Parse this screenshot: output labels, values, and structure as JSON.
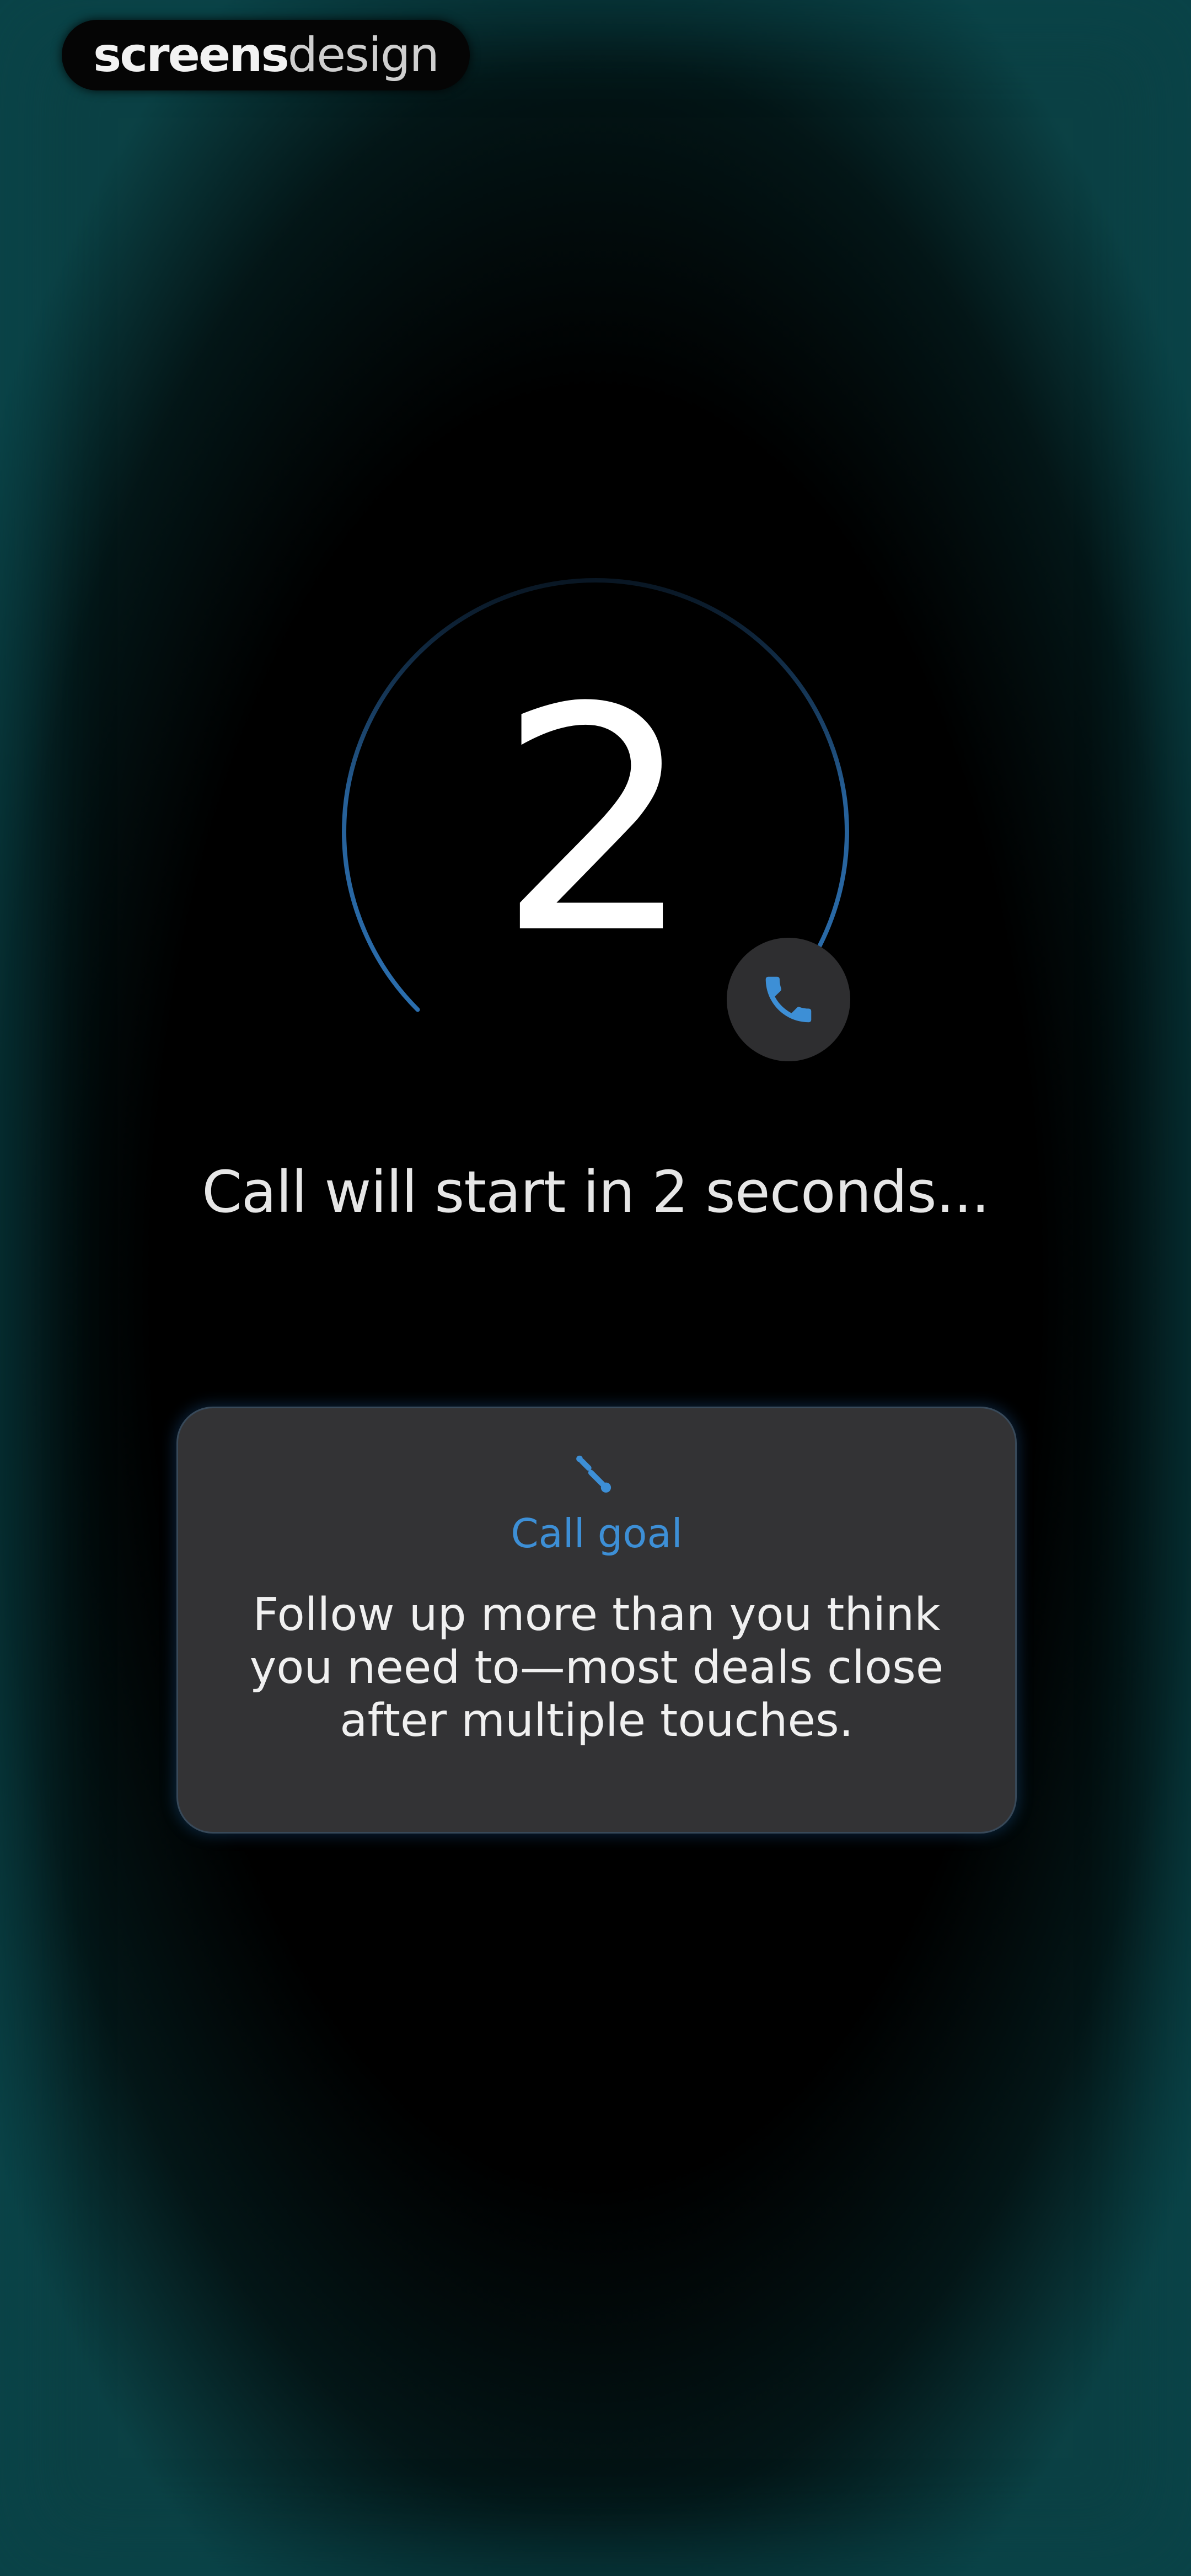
{
  "brand": {
    "strong": "screens",
    "light": "design"
  },
  "countdown": {
    "value": "2",
    "progress_fraction": 0.75,
    "ring_color": "#2a6aa8",
    "icon": "phone-icon",
    "icon_color": "#3d8fd6"
  },
  "status": {
    "text": "Call will start in 2 seconds..."
  },
  "goal_card": {
    "icon": "goal-icon",
    "label": "Call goal",
    "body": "Follow up more than you think you need to—most deals close after multiple touches."
  },
  "colors": {
    "background": "#000000",
    "edge_glow": "#0c484c",
    "accent": "#3d8fd6",
    "card": "#333335"
  }
}
